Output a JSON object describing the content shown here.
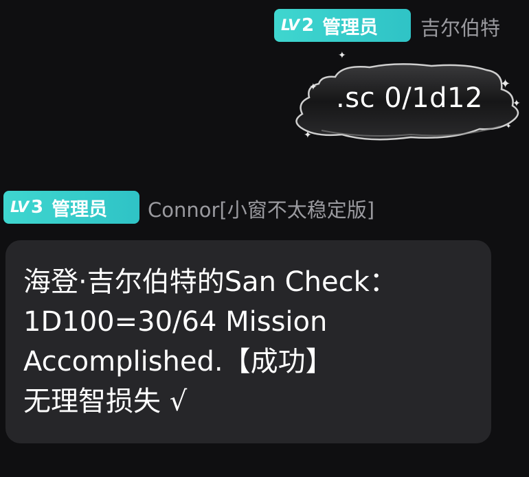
{
  "messages": [
    {
      "badge": {
        "lv_prefix": "LV",
        "lv_num": "2",
        "role": "管理员"
      },
      "sender": "吉尔伯特",
      "content": ".sc 0/1d12"
    },
    {
      "badge": {
        "lv_prefix": "LV",
        "lv_num": "3",
        "role": "管理员"
      },
      "sender": "Connor[小窗不太稳定版]",
      "lines": [
        "海登·吉尔伯特的San Check：",
        "1D100=30/64 Mission",
        "Accomplished.【成功】",
        "无理智损失 √"
      ]
    }
  ],
  "colors": {
    "background": "#0f0f11",
    "badge": "#35cbc9",
    "bubble": "#262629",
    "name": "#9a9a9f"
  }
}
